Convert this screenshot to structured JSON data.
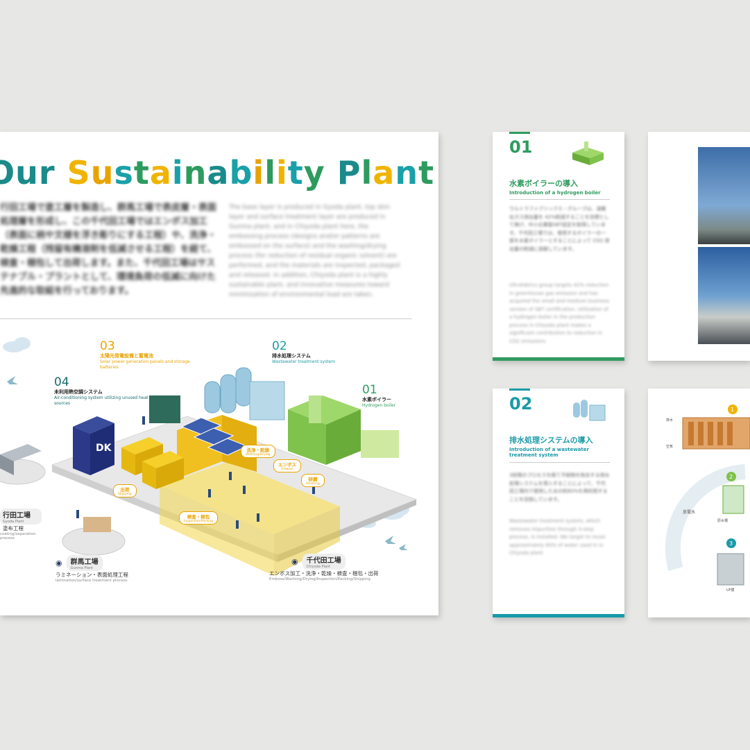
{
  "main_sheet": {
    "title_chars": [
      "O",
      "u",
      "r",
      " ",
      "S",
      "u",
      "s",
      "t",
      "a",
      "i",
      "n",
      "a",
      "b",
      "i",
      "l",
      "i",
      "t",
      "y",
      " ",
      "P",
      "l",
      "a",
      "n",
      "t"
    ],
    "title_colors": [
      "#1a8a8a",
      "#1a8a8a",
      "#1a8a8a",
      "#fff",
      "#f0b400",
      "#e8a300",
      "#1aa0a8",
      "#2e9b5e",
      "#f0b400",
      "#1aa0a8",
      "#2e9b5e",
      "#1a8a8a",
      "#1aa0a8",
      "#e8a300",
      "#2e9b5e",
      "#f0b400",
      "#1aa0a8",
      "#2e9b5e",
      "#fff",
      "#1a8a8a",
      "#2e9b5e",
      "#f0b400",
      "#1aa0a8",
      "#2e9b5e"
    ],
    "intro_jp": "行田工場で塗工層を製造し、群馬工場で表皮層・表面処理層を形成し、この千代田工場ではエンボス加工（表面に柄や文様を浮き彫りにする工程）や、洗浄・乾燥工程（残留有機溶剤を低減させる工程）を経て、検査・梱包して出荷します。また、千代田工場はサステナブル・プラントとして、環境負荷の低減に向けた先進的な取組を行っております。",
    "intro_en": "The base layer is produced in Gyoda plant, top skin layer and surface treatment layer are produced in Gunma plant, and in Chiyoda plant here, the embossing process (designs and/or patterns are embossed on the surface) and the washing/drying process (for reduction of residual organic solvent) are performed, and the materials are inspected, packaged and released. In addition, Chiyoda plant is a highly sustainable plant, and innovative measures toward minimization of environmental load are taken.",
    "callouts": [
      {
        "num": "03",
        "jp": "太陽光発電設備と蓄電池",
        "en": "Solar power generation panels and storage batteries",
        "color": "#e8a300"
      },
      {
        "num": "02",
        "jp": "排水処理システム",
        "en": "Wastewater treatment system",
        "color": "#1a9aa8"
      },
      {
        "num": "04",
        "jp": "未利用熱空調システム",
        "en": "Air-conditioning system utilizing unused heat sources",
        "color": "#1a6b6b"
      },
      {
        "num": "01",
        "jp": "水素ボイラー",
        "en": "Hydrogen boiler",
        "color": "#2e9b5e"
      }
    ],
    "process_tags": [
      {
        "jp": "洗浄・乾燥",
        "en": "Washing/Drying"
      },
      {
        "jp": "エンボス",
        "en": "Emboss"
      },
      {
        "jp": "研磨",
        "en": "Polishing"
      },
      {
        "jp": "検査・梱包",
        "en": "Inspection/Packing"
      },
      {
        "jp": "出荷",
        "en": "Shipping"
      }
    ],
    "plants": {
      "gyoda": {
        "name": "行田工場",
        "en": "Gyoda Plant",
        "proc": "塗布工程",
        "proc_en": "coating/separation process"
      },
      "gunma": {
        "name": "群馬工場",
        "en": "Gunma Plant",
        "proc": "ラミネーション・表面処理工程",
        "proc_en": "lamination/surface treatment process"
      },
      "chiyoda": {
        "name": "千代田工場",
        "en": "Chiyoda Plant",
        "proc": "エンボス加工・洗浄・乾燥・検査・梱包・出荷",
        "proc_en": "Emboss/Washing/Drying/Inspection/Packing/Shipping"
      }
    },
    "logo_text": "DK"
  },
  "card_01": {
    "num": "01",
    "jp": "水素ボイラーの導入",
    "en": "Introduction of a hydrogen boiler",
    "body_jp": "ウルトラファブリックス・グループは、温暖化ガス排出量を 42%削減することを目標として掲げ、中小企業版SBT認定を取得しています。千代田工場では、使用するボイラーの一部を水素ボイラーとすることによって CO2 排出量の削減に貢献しています。",
    "body_en": "Ultrafabrics group targets 42% reduction in greenhouse gas emission and has acquired the small and medium business version of SBT certification. Utilization of a hydrogen boiler in the production process in Chiyoda plant makes a significant contribution to reduction in CO2 emissions.",
    "accent": "#2e9b5e"
  },
  "card_02": {
    "num": "02",
    "jp": "排水処理システムの導入",
    "en": "Introduction of a wastewater treatment system",
    "body_jp": "3段階のプロセスを経て不純物を除去する排水処理システムを導入することによって、千代田工場内で使用した水の約60%を再利用することを目指しています。",
    "body_en": "Wastewater treatment system, which removes impurities through 3-step process, is installed. We target to reuse approximately 60% of water used in in Chiyoda plant",
    "accent": "#1a9aa8"
  },
  "diagram_card": {
    "labels": [
      "排水",
      "空気",
      "原水槽",
      "UF膜"
    ],
    "steps": [
      "1",
      "2",
      "3"
    ],
    "arrow_label": "放電水"
  }
}
